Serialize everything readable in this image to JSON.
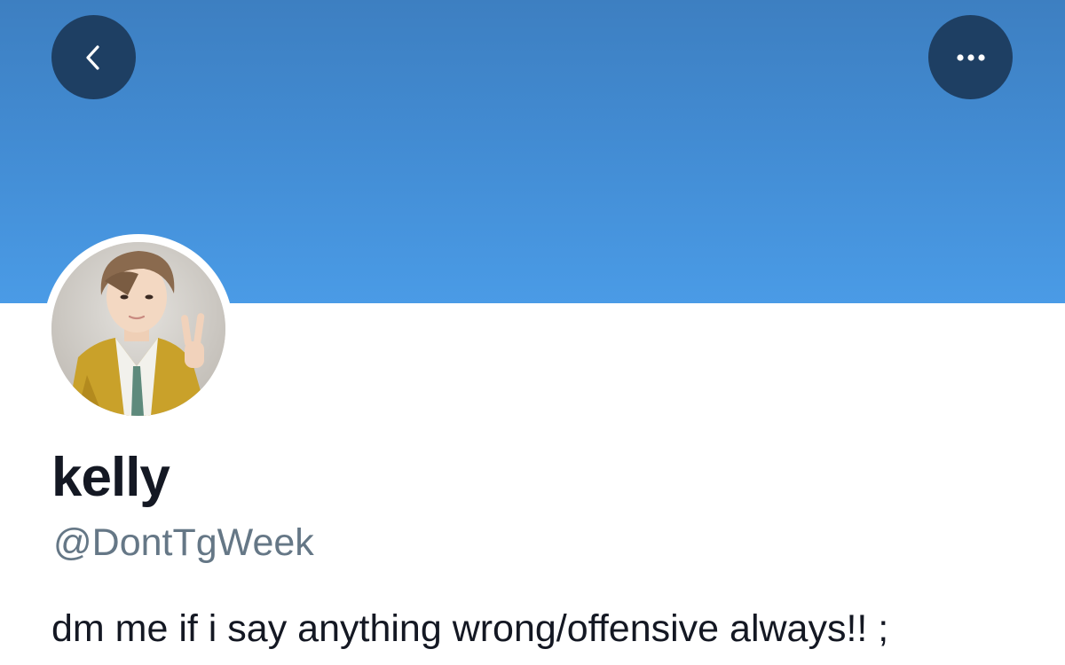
{
  "header": {
    "banner_color": "#4a9be6",
    "back_icon": "chevron-left-icon",
    "more_icon": "more-horizontal-icon",
    "button_color": "#1e3f63"
  },
  "profile": {
    "display_name": "kelly",
    "handle": "@DontTgWeek",
    "bio": "dm me if i say anything wrong/offensive always!! ;"
  },
  "colors": {
    "name_text": "#141823",
    "handle_text": "#657786"
  }
}
